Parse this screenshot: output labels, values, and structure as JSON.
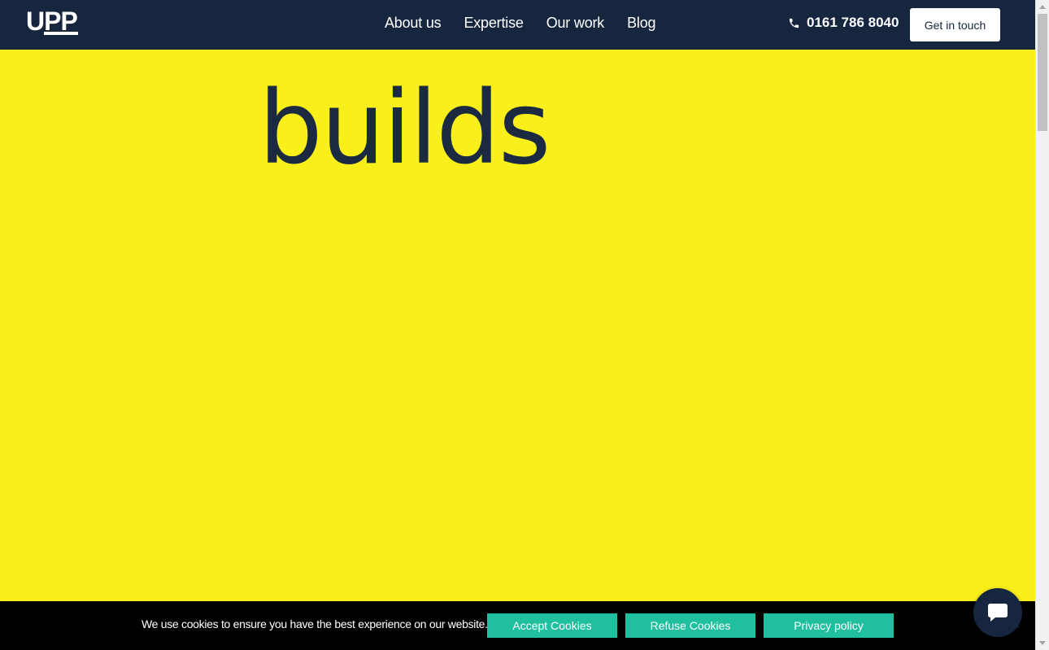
{
  "brand": {
    "logo_text": "UPP"
  },
  "nav": {
    "items": [
      {
        "label": "About us"
      },
      {
        "label": "Expertise"
      },
      {
        "label": "Our work"
      },
      {
        "label": "Blog"
      }
    ]
  },
  "header": {
    "phone": "0161 786 8040",
    "cta_label": "Get in touch"
  },
  "hero": {
    "word": "builds"
  },
  "cookie": {
    "message": "We use cookies to ensure you have the best experience on our website.",
    "accept_label": "Accept Cookies",
    "refuse_label": "Refuse Cookies",
    "privacy_label": "Privacy policy"
  },
  "colors": {
    "header_bg": "#16263f",
    "hero_bg": "#f8ef1b",
    "cookie_btn": "#1fbf9f"
  },
  "icons": {
    "phone": "phone-icon",
    "chat": "chat-icon"
  }
}
